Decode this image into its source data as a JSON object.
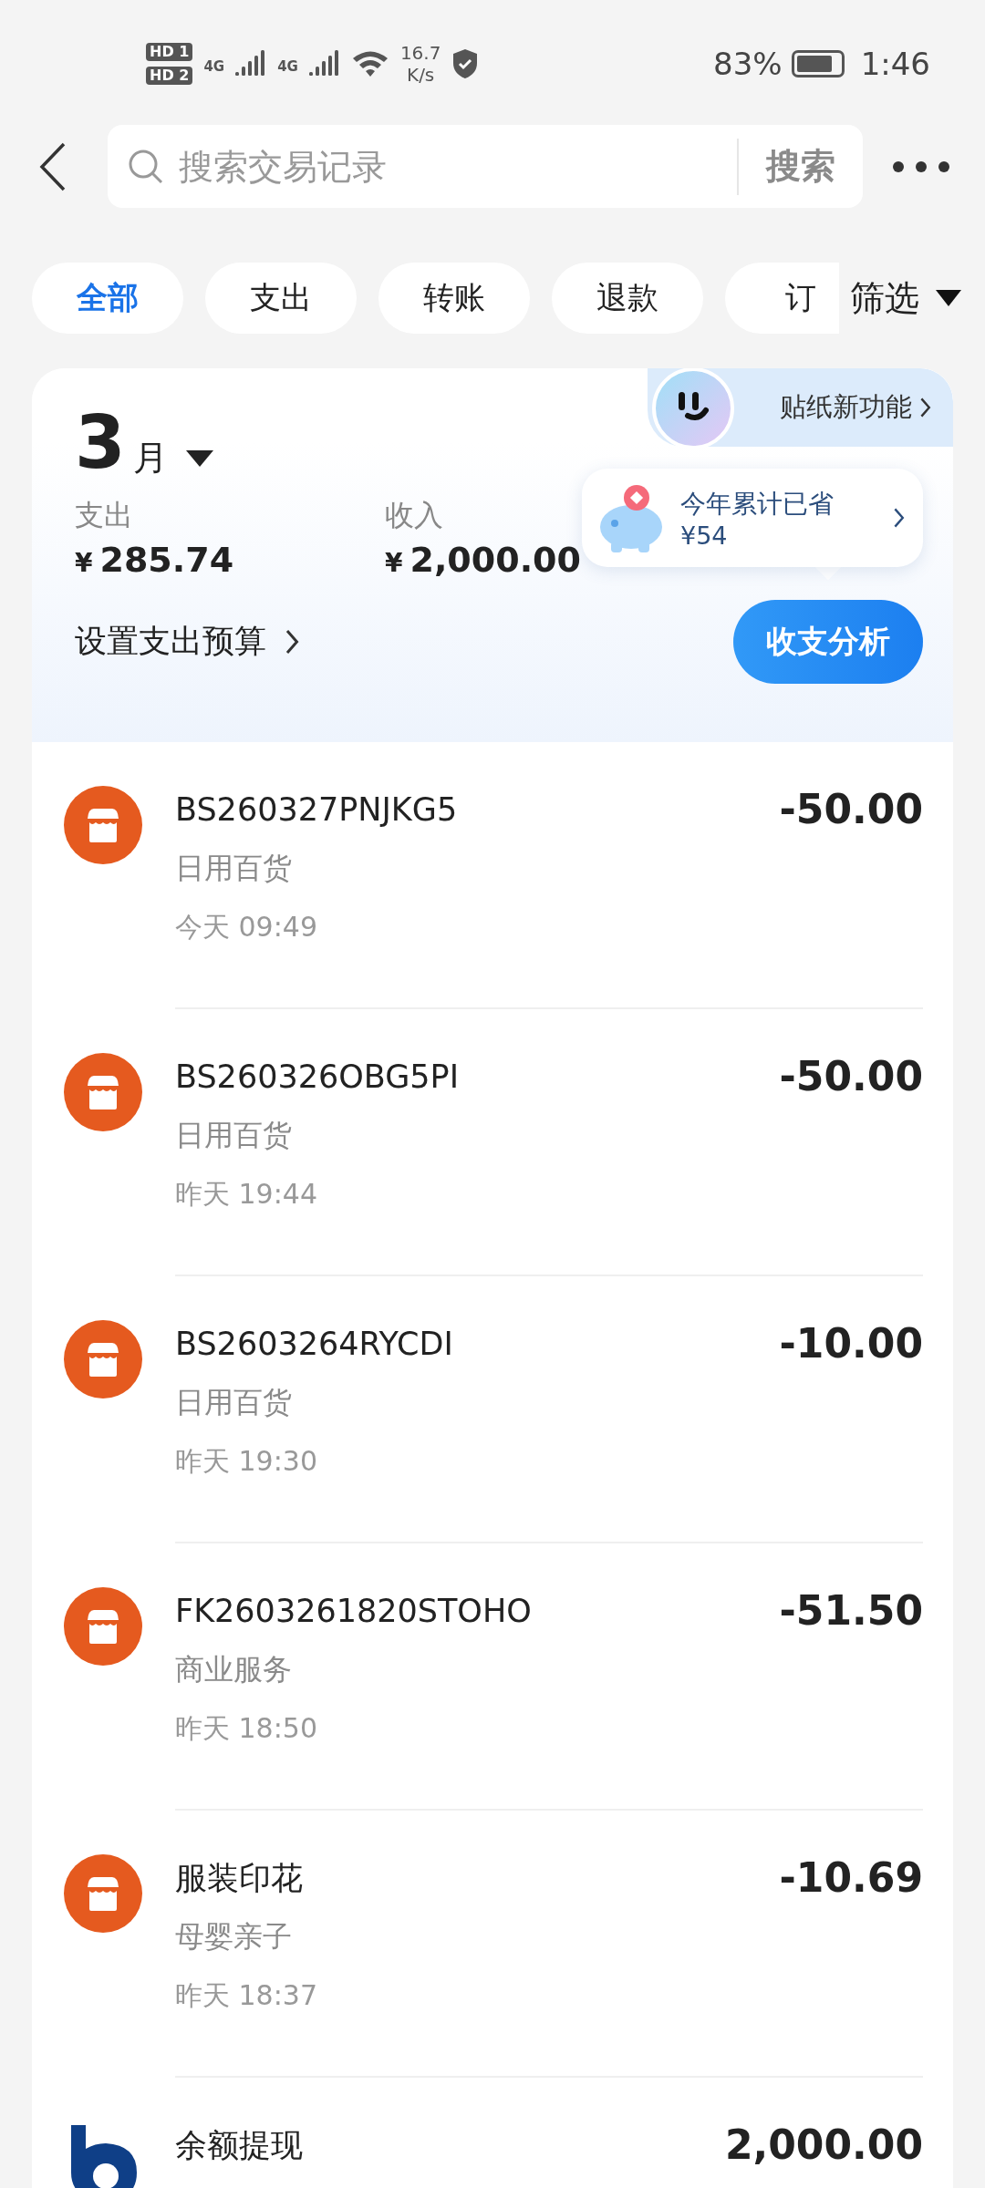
{
  "status_bar": {
    "hd_badges": [
      {
        "label": "HD",
        "slot": "1"
      },
      {
        "label": "HD",
        "slot": "2"
      }
    ],
    "networks": [
      "4G",
      "4G"
    ],
    "speed": "16.7",
    "speed_unit": "K/s",
    "battery": "83%",
    "time": "1:46"
  },
  "search": {
    "placeholder": "搜索交易记录",
    "button": "搜索"
  },
  "filters": [
    {
      "label": "全部",
      "selected": true
    },
    {
      "label": "支出",
      "selected": false
    },
    {
      "label": "转账",
      "selected": false
    },
    {
      "label": "退款",
      "selected": false
    },
    {
      "label": "订",
      "selected": false
    }
  ],
  "filter_button": "筛选",
  "summary": {
    "month": "3",
    "month_unit": "月",
    "sticker_promo": "贴纸新功能",
    "savings": {
      "title": "今年累计已省",
      "amount": "¥54"
    },
    "stats": [
      {
        "label": "支出",
        "currency": "¥",
        "amount": "285.74"
      },
      {
        "label": "收入",
        "currency": "¥",
        "amount": "2,000.00"
      }
    ],
    "budget_link": "设置支出预算",
    "analysis_button": "收支分析"
  },
  "transactions": [
    {
      "kind": "shop",
      "title": "BS260327PNJKG5",
      "category": "日用百货",
      "time": "今天 09:49",
      "amount": "-50.00"
    },
    {
      "kind": "shop",
      "title": "BS260326OBG5PI",
      "category": "日用百货",
      "time": "昨天 19:44",
      "amount": "-50.00"
    },
    {
      "kind": "shop",
      "title": "BS2603264RYCDI",
      "category": "日用百货",
      "time": "昨天 19:30",
      "amount": "-10.00"
    },
    {
      "kind": "shop",
      "title": "FK2603261820STOHO",
      "category": "商业服务",
      "time": "昨天 18:50",
      "amount": "-51.50"
    },
    {
      "kind": "shop",
      "title": "服装印花",
      "category": "母婴亲子",
      "time": "昨天 18:37",
      "amount": "-10.69"
    },
    {
      "kind": "bank",
      "title": "余额提现",
      "amount": "2,000.00"
    }
  ]
}
